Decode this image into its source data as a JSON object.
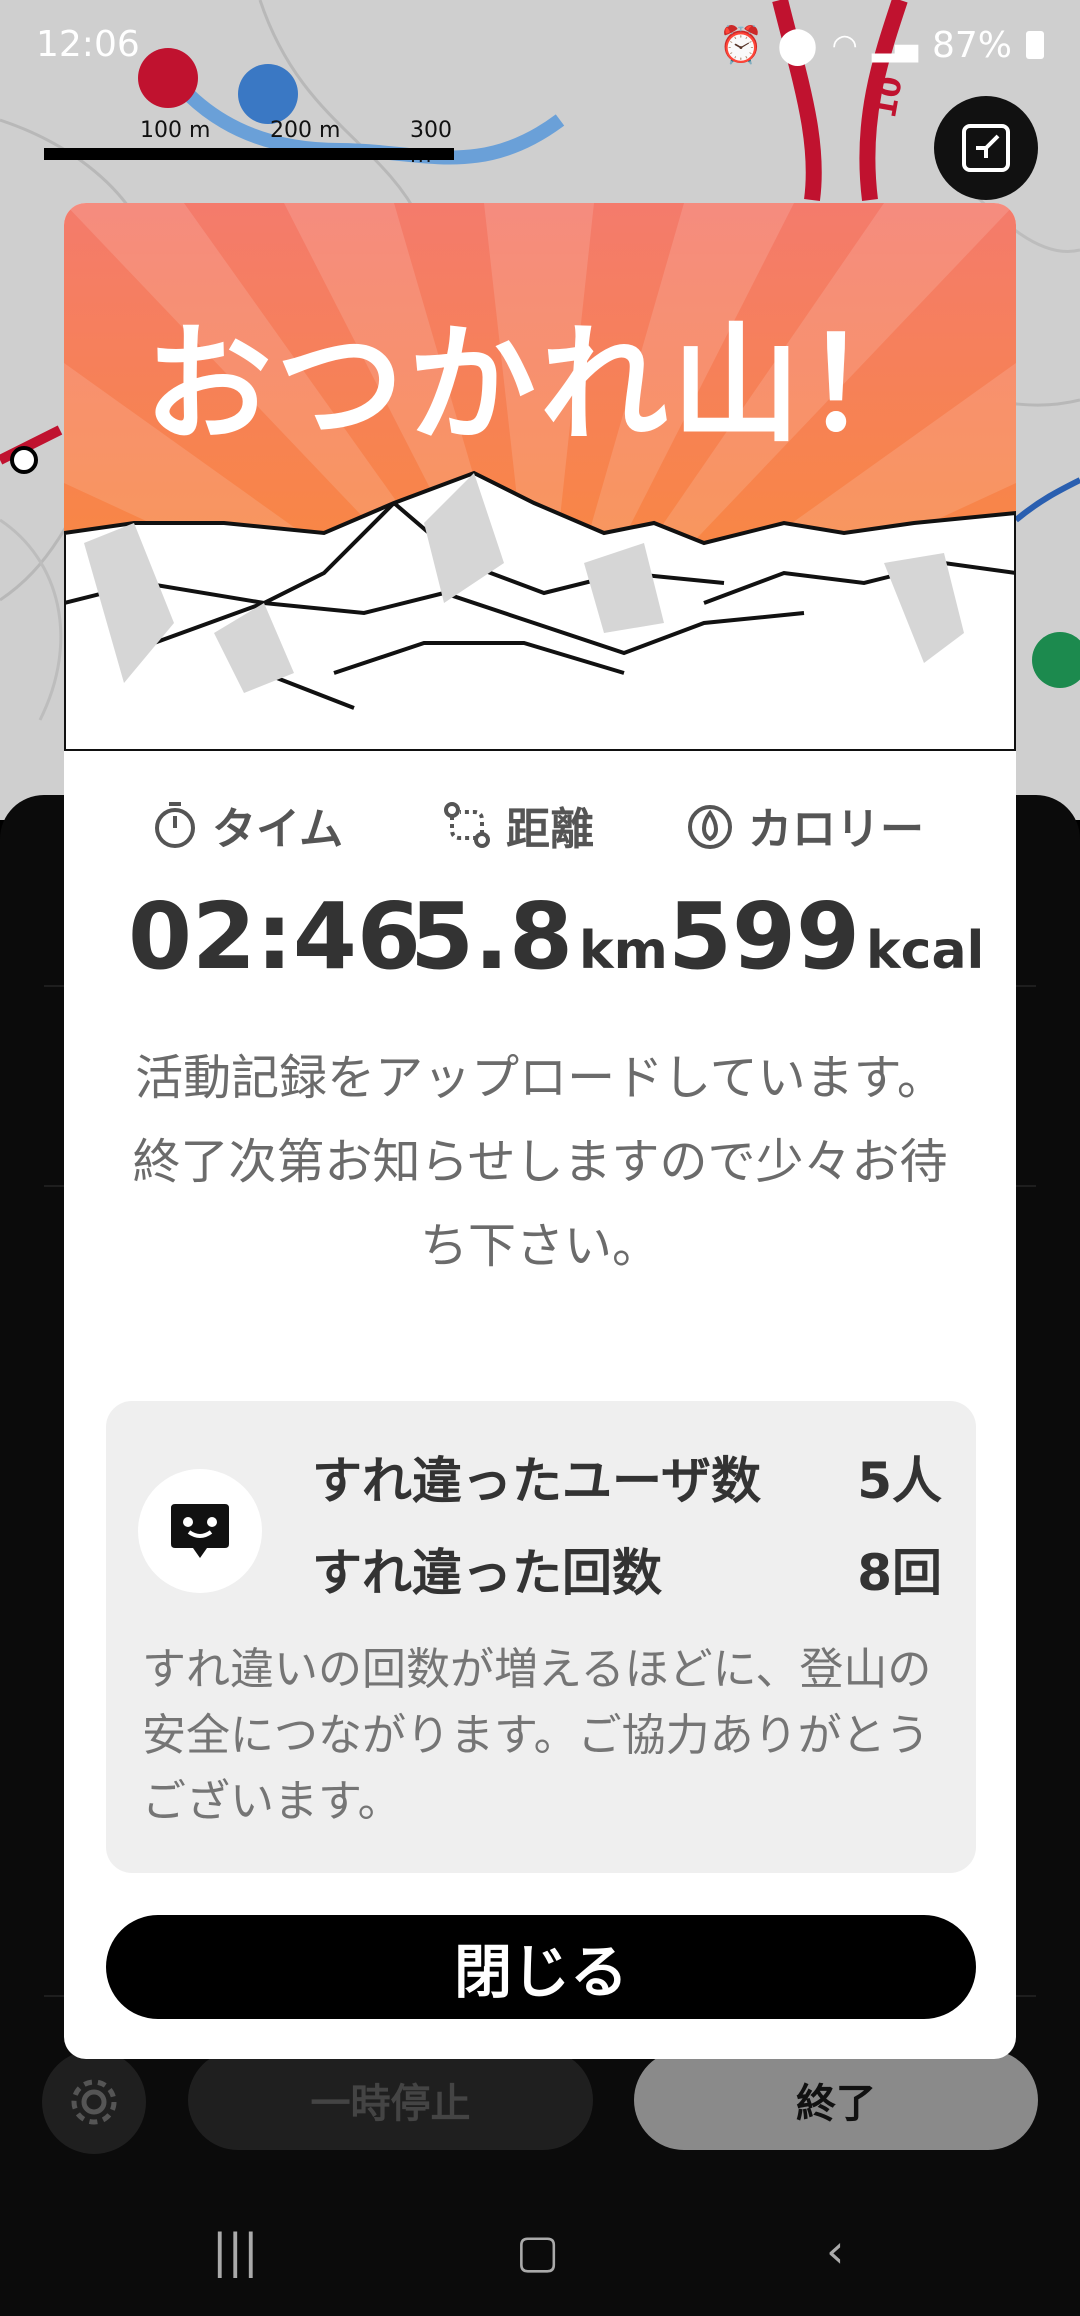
{
  "status_bar": {
    "time": "12:06",
    "battery": "87%"
  },
  "map": {
    "scale_labels": [
      "100 m",
      "200 m",
      "300 m"
    ],
    "road_label": "10"
  },
  "modal": {
    "title": "おつかれ山！",
    "stats": [
      {
        "label": "タイム",
        "value": "02:46",
        "unit": ""
      },
      {
        "label": "距離",
        "value": "5.8",
        "unit": "km"
      },
      {
        "label": "カロリー",
        "value": "599",
        "unit": "kcal"
      }
    ],
    "message": "活動記録をアップロードしています。終了次第お知らせしますので少々お待ち下さい。",
    "passing": {
      "users_label": "すれ違ったユーザ数",
      "users_value": "5人",
      "count_label": "すれ違った回数",
      "count_value": "8回",
      "note": "すれ違いの回数が増えるほどに、登山の安全につながります。ご協力ありがとうございます。"
    },
    "close_label": "閉じる"
  },
  "sheet": {
    "pause_label": "一時停止",
    "end_label": "終了"
  },
  "colors": {
    "hero_top": "#f47b6c",
    "hero_bottom": "#fb8d2e",
    "accent": "#000000"
  }
}
